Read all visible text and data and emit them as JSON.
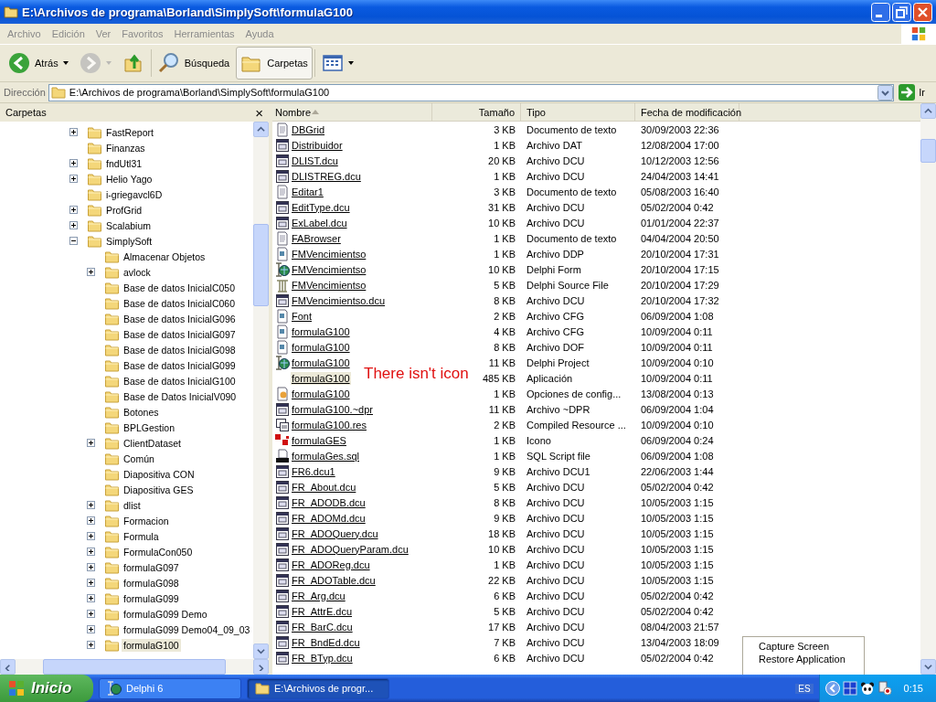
{
  "window": {
    "title": "E:\\Archivos de programa\\Borland\\SimplySoft\\formulaG100"
  },
  "menu": [
    "Archivo",
    "Edición",
    "Ver",
    "Favoritos",
    "Herramientas",
    "Ayuda"
  ],
  "toolbar": [
    {
      "kind": "back",
      "label": "Atrás",
      "selected": false,
      "disabled": false
    },
    {
      "kind": "forward",
      "selected": false,
      "disabled": true
    },
    {
      "kind": "up",
      "selected": false,
      "disabled": false
    },
    {
      "kind": "search",
      "label": "Búsqueda",
      "selected": false,
      "disabled": false
    },
    {
      "kind": "folders",
      "label": "Carpetas",
      "selected": true,
      "disabled": false
    },
    {
      "kind": "views",
      "selected": false,
      "disabled": false
    }
  ],
  "address": {
    "label": "Dirección",
    "value": "E:\\Archivos de programa\\Borland\\SimplySoft\\formulaG100",
    "go": "Ir"
  },
  "folders_pane": {
    "title": "Carpetas",
    "close": "×",
    "tree": [
      {
        "label": "FastReport",
        "expanded": false,
        "selected": false
      },
      {
        "label": "Finanzas",
        "selected": false
      },
      {
        "label": "fndUtl31",
        "expanded": false,
        "selected": false
      },
      {
        "label": "Helio Yago",
        "expanded": false,
        "selected": false
      },
      {
        "label": "i-griegavcl6D",
        "selected": false
      },
      {
        "label": "ProfGrid",
        "expanded": false,
        "selected": false
      },
      {
        "label": "Scalabium",
        "expanded": false,
        "selected": false
      },
      {
        "label": "SimplySoft",
        "expanded": true,
        "selected": false,
        "children": [
          {
            "label": "Almacenar Objetos",
            "selected": false
          },
          {
            "label": "avlock",
            "expanded": false,
            "selected": false
          },
          {
            "label": "Base de datos InicialC050",
            "selected": false
          },
          {
            "label": "Base de datos InicialC060",
            "selected": false
          },
          {
            "label": "Base de datos InicialG096",
            "selected": false
          },
          {
            "label": "Base de datos InicialG097",
            "selected": false
          },
          {
            "label": "Base de datos InicialG098",
            "selected": false
          },
          {
            "label": "Base de datos InicialG099",
            "selected": false
          },
          {
            "label": "Base de datos InicialG100",
            "selected": false
          },
          {
            "label": "Base de Datos InicialV090",
            "selected": false
          },
          {
            "label": "Botones",
            "selected": false
          },
          {
            "label": "BPLGestion",
            "selected": false
          },
          {
            "label": "ClientDataset",
            "expanded": false,
            "selected": false
          },
          {
            "label": "Común",
            "selected": false
          },
          {
            "label": "Diapositiva CON",
            "selected": false
          },
          {
            "label": "Diapositiva GES",
            "selected": false
          },
          {
            "label": "dlist",
            "expanded": false,
            "selected": false
          },
          {
            "label": "Formacion",
            "expanded": false,
            "selected": false
          },
          {
            "label": "Formula",
            "expanded": false,
            "selected": false
          },
          {
            "label": "FormulaCon050",
            "expanded": false,
            "selected": false
          },
          {
            "label": "formulaG097",
            "expanded": false,
            "selected": false
          },
          {
            "label": "formulaG098",
            "expanded": false,
            "selected": false
          },
          {
            "label": "formulaG099",
            "expanded": false,
            "selected": false
          },
          {
            "label": "formulaG099 Demo",
            "expanded": false,
            "selected": false
          },
          {
            "label": "formulaG099 Demo04_09_03",
            "expanded": false,
            "selected": false
          },
          {
            "label": "formulaG100",
            "expanded": false,
            "selected": true
          }
        ]
      }
    ]
  },
  "columns": [
    {
      "label": "Nombre",
      "sorted": true
    },
    {
      "label": "Tamaño"
    },
    {
      "label": "Tipo"
    },
    {
      "label": "Fecha de modificación"
    }
  ],
  "files": [
    {
      "kind": "text",
      "name": "DBGrid",
      "size": "3 KB",
      "type": "Documento de texto",
      "modified": "30/09/2003 22:36",
      "selected": false
    },
    {
      "kind": "dcu",
      "name": "Distribuidor",
      "size": "1 KB",
      "type": "Archivo DAT",
      "modified": "12/08/2004 17:00",
      "selected": false
    },
    {
      "kind": "dcu",
      "name": "DLIST.dcu",
      "size": "20 KB",
      "type": "Archivo DCU",
      "modified": "10/12/2003 12:56",
      "selected": false
    },
    {
      "kind": "dcu",
      "name": "DLISTREG.dcu",
      "size": "1 KB",
      "type": "Archivo DCU",
      "modified": "24/04/2003 14:41",
      "selected": false
    },
    {
      "kind": "text",
      "name": "Editar1",
      "size": "3 KB",
      "type": "Documento de texto",
      "modified": "05/08/2003 16:40",
      "selected": false
    },
    {
      "kind": "dcu",
      "name": "EditType.dcu",
      "size": "31 KB",
      "type": "Archivo DCU",
      "modified": "05/02/2004 0:42",
      "selected": false
    },
    {
      "kind": "dcu",
      "name": "ExLabel.dcu",
      "size": "10 KB",
      "type": "Archivo DCU",
      "modified": "01/01/2004 22:37",
      "selected": false
    },
    {
      "kind": "text",
      "name": "FABrowser",
      "size": "1 KB",
      "type": "Documento de texto",
      "modified": "04/04/2004 20:50",
      "selected": false
    },
    {
      "kind": "config",
      "name": "FMVencimientso",
      "size": "1 KB",
      "type": "Archivo DDP",
      "modified": "20/10/2004 17:31",
      "selected": false
    },
    {
      "kind": "delphi",
      "name": "FMVencimientso",
      "size": "10 KB",
      "type": "Delphi Form",
      "modified": "20/10/2004 17:15",
      "selected": false
    },
    {
      "kind": "source",
      "name": "FMVencimientso",
      "size": "5 KB",
      "type": "Delphi Source File",
      "modified": "20/10/2004 17:29",
      "selected": false
    },
    {
      "kind": "dcu",
      "name": "FMVencimientso.dcu",
      "size": "8 KB",
      "type": "Archivo DCU",
      "modified": "20/10/2004 17:32",
      "selected": false
    },
    {
      "kind": "config",
      "name": "Font",
      "size": "2 KB",
      "type": "Archivo CFG",
      "modified": "06/09/2004 1:08",
      "selected": false
    },
    {
      "kind": "config",
      "name": "formulaG100",
      "size": "4 KB",
      "type": "Archivo CFG",
      "modified": "10/09/2004 0:11",
      "selected": false
    },
    {
      "kind": "config",
      "name": "formulaG100",
      "size": "8 KB",
      "type": "Archivo DOF",
      "modified": "10/09/2004 0:11",
      "selected": false
    },
    {
      "kind": "delphi",
      "name": "formulaG100",
      "size": "11 KB",
      "type": "Delphi Project",
      "modified": "10/09/2004 0:10",
      "selected": false
    },
    {
      "kind": "none",
      "name": "formulaG100",
      "size": "485 KB",
      "type": "Aplicación",
      "modified": "10/09/2004 0:11",
      "selected": true
    },
    {
      "kind": "options",
      "name": "formulaG100",
      "size": "1 KB",
      "type": "Opciones de config...",
      "modified": "13/08/2004 0:13",
      "selected": false
    },
    {
      "kind": "dcu",
      "name": "formulaG100.~dpr",
      "size": "11 KB",
      "type": "Archivo ~DPR",
      "modified": "06/09/2004 1:04",
      "selected": false
    },
    {
      "kind": "resource",
      "name": "formulaG100.res",
      "size": "2 KB",
      "type": "Compiled Resource ...",
      "modified": "10/09/2004 0:10",
      "selected": false
    },
    {
      "kind": "ico",
      "name": "formulaGES",
      "size": "1 KB",
      "type": "Icono",
      "modified": "06/09/2004 0:24",
      "selected": false
    },
    {
      "kind": "sql",
      "name": "formulaGes.sql",
      "size": "1 KB",
      "type": "SQL Script file",
      "modified": "06/09/2004 1:08",
      "selected": false
    },
    {
      "kind": "dcu",
      "name": "FR6.dcu1",
      "size": "9 KB",
      "type": "Archivo DCU1",
      "modified": "22/06/2003 1:44",
      "selected": false
    },
    {
      "kind": "dcu",
      "name": "FR_About.dcu",
      "size": "5 KB",
      "type": "Archivo DCU",
      "modified": "05/02/2004 0:42",
      "selected": false
    },
    {
      "kind": "dcu",
      "name": "FR_ADODB.dcu",
      "size": "8 KB",
      "type": "Archivo DCU",
      "modified": "10/05/2003 1:15",
      "selected": false
    },
    {
      "kind": "dcu",
      "name": "FR_ADOMd.dcu",
      "size": "9 KB",
      "type": "Archivo DCU",
      "modified": "10/05/2003 1:15",
      "selected": false
    },
    {
      "kind": "dcu",
      "name": "FR_ADOQuery.dcu",
      "size": "18 KB",
      "type": "Archivo DCU",
      "modified": "10/05/2003 1:15",
      "selected": false
    },
    {
      "kind": "dcu",
      "name": "FR_ADOQueryParam.dcu",
      "size": "10 KB",
      "type": "Archivo DCU",
      "modified": "10/05/2003 1:15",
      "selected": false
    },
    {
      "kind": "dcu",
      "name": "FR_ADOReg.dcu",
      "size": "1 KB",
      "type": "Archivo DCU",
      "modified": "10/05/2003 1:15",
      "selected": false
    },
    {
      "kind": "dcu",
      "name": "FR_ADOTable.dcu",
      "size": "22 KB",
      "type": "Archivo DCU",
      "modified": "10/05/2003 1:15",
      "selected": false
    },
    {
      "kind": "dcu",
      "name": "FR_Arg.dcu",
      "size": "6 KB",
      "type": "Archivo DCU",
      "modified": "05/02/2004 0:42",
      "selected": false
    },
    {
      "kind": "dcu",
      "name": "FR_AttrE.dcu",
      "size": "5 KB",
      "type": "Archivo DCU",
      "modified": "05/02/2004 0:42",
      "selected": false
    },
    {
      "kind": "dcu",
      "name": "FR_BarC.dcu",
      "size": "17 KB",
      "type": "Archivo DCU",
      "modified": "08/04/2003 21:57",
      "selected": false
    },
    {
      "kind": "dcu",
      "name": "FR_BndEd.dcu",
      "size": "7 KB",
      "type": "Archivo DCU",
      "modified": "13/04/2003 18:09",
      "selected": false
    },
    {
      "kind": "dcu",
      "name": "FR_BTyp.dcu",
      "size": "6 KB",
      "type": "Archivo DCU",
      "modified": "05/02/2004 0:42",
      "selected": false
    }
  ],
  "annotation": "There isn't icon",
  "context_menu": [
    "Capture Screen",
    "Restore Application"
  ],
  "taskbar": {
    "start": "Inicio",
    "tasks": [
      {
        "label": "Delphi 6",
        "kind": "delphi",
        "selected": false
      },
      {
        "label": "E:\\Archivos de progr...",
        "kind": "folder",
        "selected": true
      }
    ],
    "language": "ES",
    "clock": "0:15"
  }
}
